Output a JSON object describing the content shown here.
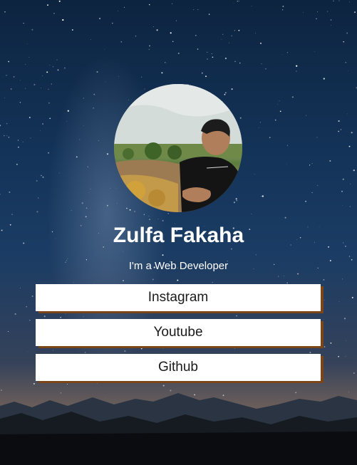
{
  "profile": {
    "name": "Zulfa Fakaha",
    "tagline": "I'm a Web Developer"
  },
  "links": [
    {
      "label": "Instagram"
    },
    {
      "label": "Youtube"
    },
    {
      "label": "Github"
    }
  ],
  "colors": {
    "button_bg": "#ffffff",
    "button_shadow": "#7b4518",
    "text_light": "#ffffff",
    "sky": "#14345a"
  }
}
